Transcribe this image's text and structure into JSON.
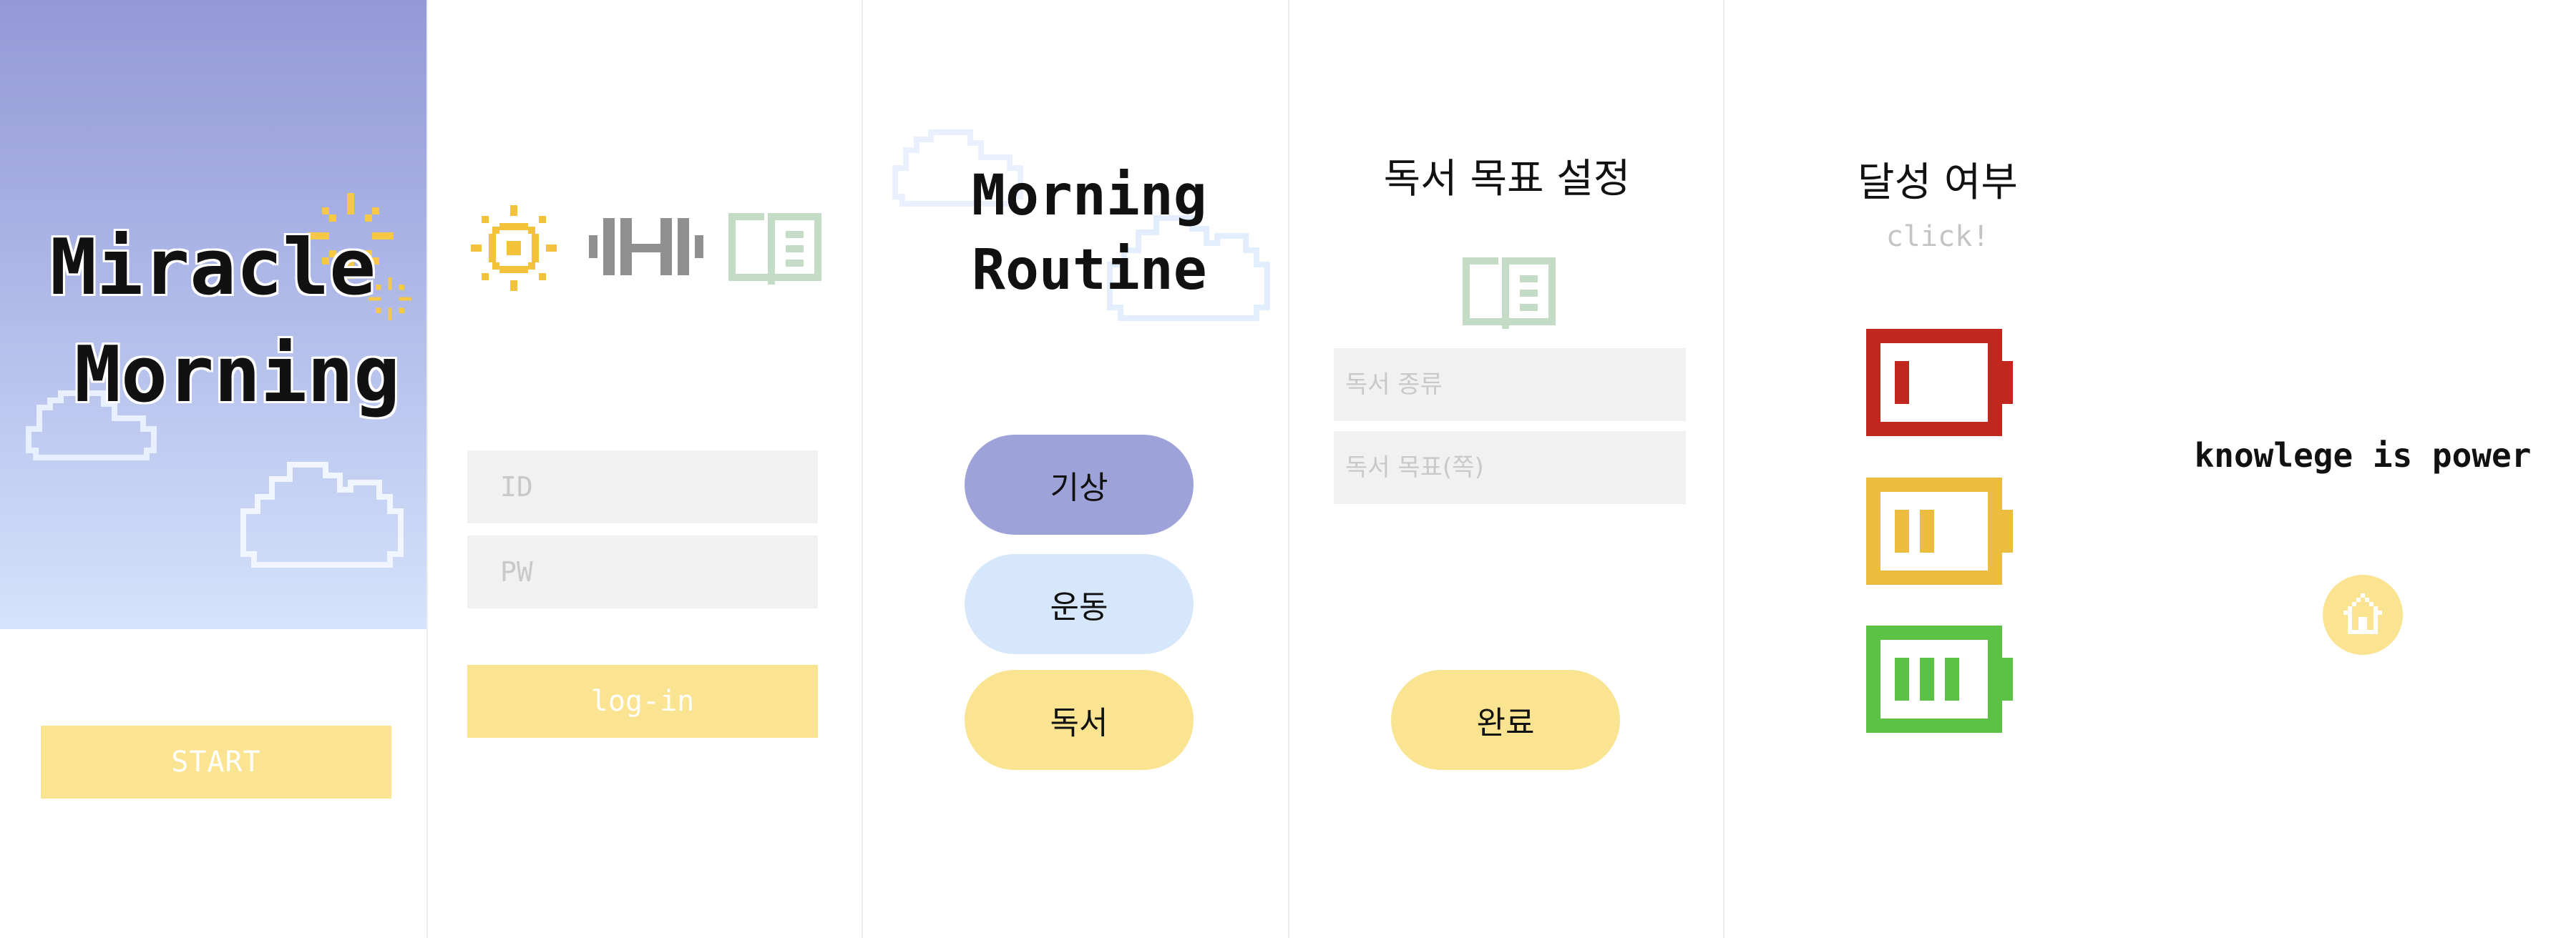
{
  "screens": {
    "splash": {
      "title_line1": "Miracle",
      "title_line2": "Morning",
      "start_label": "START"
    },
    "login": {
      "icons": [
        "sun-icon",
        "dumbbell-icon",
        "book-icon"
      ],
      "id_placeholder": "ID",
      "pw_placeholder": "PW",
      "login_label": "log-in"
    },
    "routine": {
      "title_line1": "Morning",
      "title_line2": "Routine",
      "buttons": [
        {
          "label": "기상",
          "color": "#9da3d9"
        },
        {
          "label": "운동",
          "color": "#d6e6fb"
        },
        {
          "label": "독서",
          "color": "#fae491"
        }
      ]
    },
    "reading_goal": {
      "title": "독서 목표 설정",
      "icon": "book-icon",
      "type_placeholder": "독서 종류",
      "goal_placeholder": "독서 목표(쪽)",
      "done_label": "완료"
    },
    "achievement": {
      "title": "달성 여부",
      "subtitle": "click!",
      "batteries": [
        {
          "level": 1,
          "max": 3,
          "color": "#c0281f"
        },
        {
          "level": 2,
          "max": 3,
          "color": "#ebbc3e"
        },
        {
          "level": 3,
          "max": 3,
          "color": "#5cc245"
        }
      ]
    },
    "quote": {
      "text": "knowlege is power",
      "home_icon": "home-icon"
    }
  },
  "colors": {
    "accent_yellow": "#fae491",
    "sky_top": "#9399d6",
    "sky_bottom": "#d5e3fb",
    "input_bg": "#f1f1f1"
  }
}
